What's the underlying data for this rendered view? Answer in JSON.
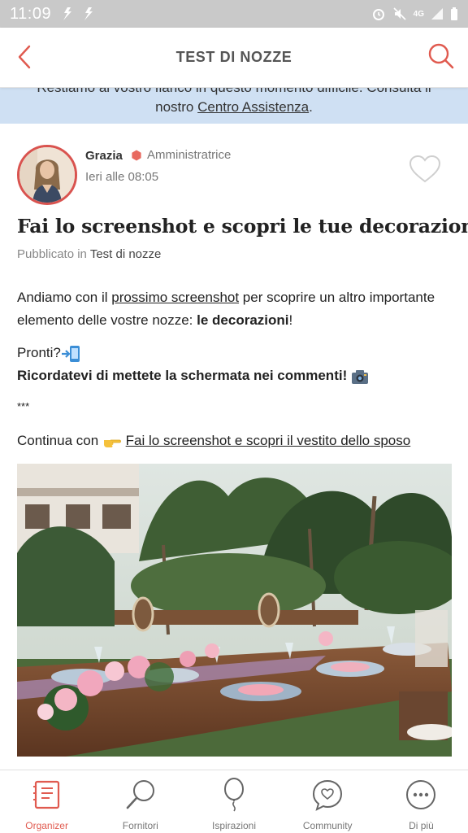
{
  "status_bar": {
    "time": "11:09",
    "network_label": "4G"
  },
  "header": {
    "title": "TEST DI NOZZE"
  },
  "notice": {
    "line1": "Restiamo al vostro fianco in questo momento difficile. Consulta il",
    "line2_prefix": "nostro ",
    "line2_link": "Centro Assistenza",
    "line2_suffix": "."
  },
  "post": {
    "author": {
      "name": "Grazia",
      "role": "Amministratrice",
      "time": "Ieri alle 08:05"
    },
    "title": "Fai lo screenshot e scopri le tue decorazioni",
    "meta": {
      "prefix": "Pubblicato in",
      "category": "Test di nozze"
    },
    "paragraph1": {
      "before_link": "Andiamo con il ",
      "link": "prossimo screenshot",
      "after_link": " per scoprire un altro importante elemento delle vostre nozze: ",
      "bold": "le decorazioni",
      "end": "!"
    },
    "paragraph2": {
      "line1": "Pronti?",
      "line2": "Ricordatevi di mettete la schermata nei commenti!"
    },
    "separator": "***",
    "continue": {
      "prefix": "Continua con",
      "link": "Fai lo screenshot e scopri il vestito dello sposo"
    }
  },
  "bottom_nav": {
    "items": [
      {
        "label": "Organizer",
        "icon": "organizer-icon",
        "active": true
      },
      {
        "label": "Fornitori",
        "icon": "magnifier-icon",
        "active": false
      },
      {
        "label": "Ispirazioni",
        "icon": "balloon-icon",
        "active": false
      },
      {
        "label": "Community",
        "icon": "chat-heart-icon",
        "active": false
      },
      {
        "label": "Di più",
        "icon": "more-icon",
        "active": false
      }
    ]
  },
  "colors": {
    "accent": "#e05a4f",
    "banner": "#cfe0f3",
    "status_bar": "#c9c9c9"
  }
}
